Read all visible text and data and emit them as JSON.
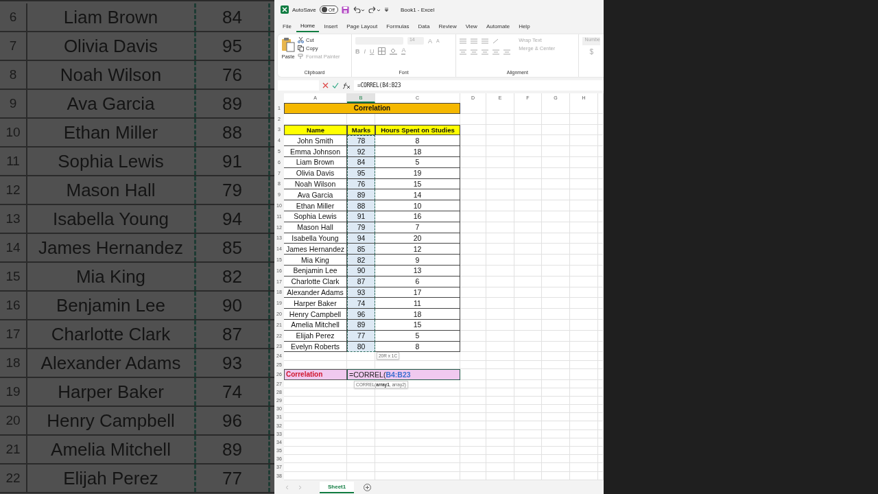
{
  "background_zoom": {
    "rows": [
      {
        "row": "6",
        "name": "Liam Brown",
        "marks": "84"
      },
      {
        "row": "7",
        "name": "Olivia Davis",
        "marks": "95"
      },
      {
        "row": "8",
        "name": "Noah Wilson",
        "marks": "76"
      },
      {
        "row": "9",
        "name": "Ava Garcia",
        "marks": "89"
      },
      {
        "row": "10",
        "name": "Ethan Miller",
        "marks": "88"
      },
      {
        "row": "11",
        "name": "Sophia Lewis",
        "marks": "91"
      },
      {
        "row": "12",
        "name": "Mason Hall",
        "marks": "79"
      },
      {
        "row": "13",
        "name": "Isabella Young",
        "marks": "94"
      },
      {
        "row": "14",
        "name": "James Hernandez",
        "marks": "85"
      },
      {
        "row": "15",
        "name": "Mia King",
        "marks": "82"
      },
      {
        "row": "16",
        "name": "Benjamin Lee",
        "marks": "90"
      },
      {
        "row": "17",
        "name": "Charlotte Clark",
        "marks": "87"
      },
      {
        "row": "18",
        "name": "Alexander Adams",
        "marks": "93"
      },
      {
        "row": "19",
        "name": "Harper Baker",
        "marks": "74"
      },
      {
        "row": "20",
        "name": "Henry Campbell",
        "marks": "96"
      },
      {
        "row": "21",
        "name": "Amelia Mitchell",
        "marks": "89"
      },
      {
        "row": "22",
        "name": "Elijah Perez",
        "marks": "77"
      }
    ]
  },
  "excel": {
    "title_bar": {
      "autosave_label": "AutoSave",
      "autosave_state": "Off",
      "autosave_on": false,
      "title": "Book1  -  Excel"
    },
    "menu_tabs": [
      {
        "label": "File",
        "selected": false
      },
      {
        "label": "Home",
        "selected": true
      },
      {
        "label": "Insert",
        "selected": false
      },
      {
        "label": "Page Layout",
        "selected": false
      },
      {
        "label": "Formulas",
        "selected": false
      },
      {
        "label": "Data",
        "selected": false
      },
      {
        "label": "Review",
        "selected": false
      },
      {
        "label": "View",
        "selected": false
      },
      {
        "label": "Automate",
        "selected": false
      },
      {
        "label": "Help",
        "selected": false
      }
    ],
    "ribbon": {
      "clipboard": {
        "paste": "Paste",
        "cut": "Cut",
        "copy": "Copy",
        "format_painter": "Format Painter",
        "label": "Clipboard"
      },
      "font": {
        "size": "14",
        "grow": "A",
        "shrink": "A",
        "bold": "B",
        "italic": "I",
        "underline": "U",
        "font_color": "A",
        "label": "Font"
      },
      "alignment": {
        "wrap_text": "Wrap Text",
        "merge_center": "Merge & Center",
        "label": "Alignment"
      },
      "number": {
        "format": "Numbe",
        "currency": "$"
      }
    },
    "formula_bar": {
      "formula": "=CORREL(B4:B23"
    },
    "columns": [
      {
        "label": "A",
        "selected": false
      },
      {
        "label": "B",
        "selected": true
      },
      {
        "label": "C",
        "selected": false
      },
      {
        "label": "D",
        "selected": false
      },
      {
        "label": "E",
        "selected": false
      },
      {
        "label": "F",
        "selected": false
      },
      {
        "label": "G",
        "selected": false
      },
      {
        "label": "H",
        "selected": false
      }
    ],
    "row_numbers": [
      "1",
      "2",
      "3",
      "4",
      "5",
      "6",
      "7",
      "8",
      "9",
      "10",
      "11",
      "12",
      "13",
      "14",
      "15",
      "16",
      "17",
      "18",
      "19",
      "20",
      "21",
      "22",
      "23",
      "24",
      "25",
      "26",
      "27",
      "28",
      "29",
      "30",
      "31",
      "32",
      "33",
      "34",
      "35",
      "36",
      "37",
      "38"
    ],
    "title_cell": "Correlation",
    "headers": [
      "Name",
      "Marks",
      "Hours Spent on Studies"
    ],
    "rows": [
      {
        "name": "John Smith",
        "marks": "78",
        "hours": "8"
      },
      {
        "name": "Emma Johnson",
        "marks": "92",
        "hours": "18"
      },
      {
        "name": "Liam Brown",
        "marks": "84",
        "hours": "5"
      },
      {
        "name": "Olivia Davis",
        "marks": "95",
        "hours": "19"
      },
      {
        "name": "Noah Wilson",
        "marks": "76",
        "hours": "15"
      },
      {
        "name": "Ava Garcia",
        "marks": "89",
        "hours": "14"
      },
      {
        "name": "Ethan Miller",
        "marks": "88",
        "hours": "10"
      },
      {
        "name": "Sophia Lewis",
        "marks": "91",
        "hours": "16"
      },
      {
        "name": "Mason Hall",
        "marks": "79",
        "hours": "7"
      },
      {
        "name": "Isabella Young",
        "marks": "94",
        "hours": "20"
      },
      {
        "name": "James Hernandez",
        "marks": "85",
        "hours": "12"
      },
      {
        "name": "Mia King",
        "marks": "82",
        "hours": "9"
      },
      {
        "name": "Benjamin Lee",
        "marks": "90",
        "hours": "13"
      },
      {
        "name": "Charlotte Clark",
        "marks": "87",
        "hours": "6"
      },
      {
        "name": "Alexander Adams",
        "marks": "93",
        "hours": "17"
      },
      {
        "name": "Harper Baker",
        "marks": "74",
        "hours": "11"
      },
      {
        "name": "Henry Campbell",
        "marks": "96",
        "hours": "18"
      },
      {
        "name": "Amelia Mitchell",
        "marks": "89",
        "hours": "15"
      },
      {
        "name": "Elijah Perez",
        "marks": "77",
        "hours": "5"
      },
      {
        "name": "Evelyn Roberts",
        "marks": "80",
        "hours": "8"
      }
    ],
    "selection_size_tip": "20R x 1C",
    "result_row": {
      "label": "Correlation",
      "formula_prefix": "=CORREL(",
      "formula_ref": "B4:B23"
    },
    "function_tip": "CORREL(**array1**, array2)",
    "sheet_tabs": [
      {
        "label": "Sheet1",
        "selected": true
      }
    ]
  }
}
